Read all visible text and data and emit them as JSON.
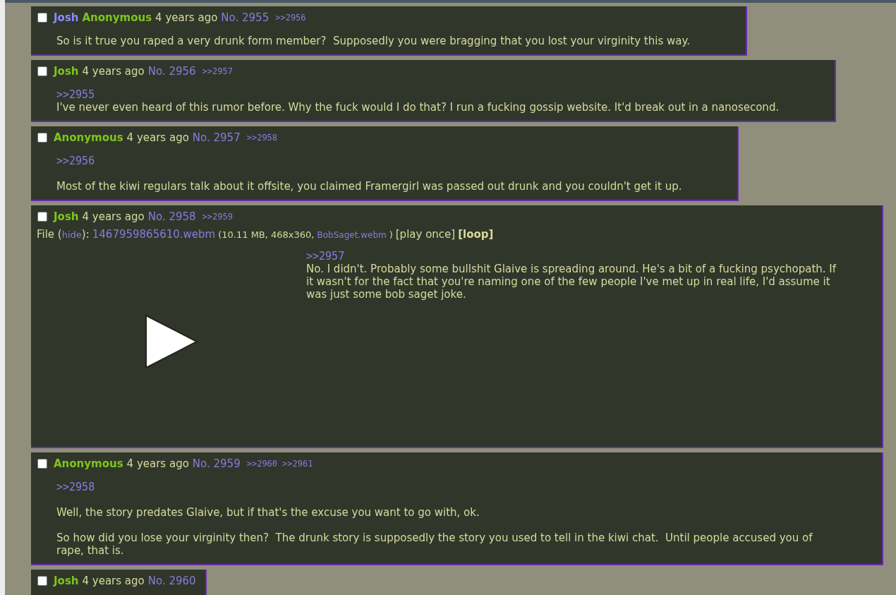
{
  "posts": [
    {
      "checked": false,
      "names": [
        {
          "kind": "link",
          "text": "Josh"
        },
        {
          "kind": "name",
          "text": "Anonymous"
        }
      ],
      "time": "4 years ago",
      "number": "No. 2955",
      "replies": [
        ">>2956"
      ],
      "body": [
        {
          "lines": [
            {
              "kind": "text",
              "text": "So is it true you raped a very drunk form member?  Supposedly you were bragging that you lost your virginity this way."
            }
          ]
        }
      ]
    },
    {
      "checked": false,
      "names": [
        {
          "kind": "name",
          "text": "Josh"
        }
      ],
      "time": "4 years ago",
      "number": "No. 2956",
      "replies": [
        ">>2957"
      ],
      "body": [
        {
          "lines": [
            {
              "kind": "quote",
              "text": ">>2955"
            },
            {
              "kind": "text",
              "text": "I've never even heard of this rumor before. Why the fuck would I do that? I run a fucking gossip website. It'd break out in a nanosecond."
            }
          ]
        }
      ]
    },
    {
      "checked": false,
      "names": [
        {
          "kind": "name",
          "text": "Anonymous"
        }
      ],
      "time": "4 years ago",
      "number": "No. 2957",
      "replies": [
        ">>2958"
      ],
      "body": [
        {
          "lines": [
            {
              "kind": "quote",
              "text": ">>2956"
            }
          ]
        },
        {
          "lines": [
            {
              "kind": "text",
              "text": "Most of the kiwi regulars talk about it offsite, you claimed Framergirl was passed out drunk and you couldn't get it up."
            }
          ]
        }
      ]
    },
    {
      "checked": false,
      "names": [
        {
          "kind": "name",
          "text": "Josh"
        }
      ],
      "time": "4 years ago",
      "number": "No. 2958",
      "replies": [
        ">>2959"
      ],
      "file": [
        {
          "kind": "text",
          "text": "File ("
        },
        {
          "kind": "link",
          "text": "hide"
        },
        {
          "kind": "text",
          "text": "):"
        },
        {
          "kind": "filename",
          "text": "1467959865610.webm"
        },
        {
          "kind": "small",
          "text": "(10.11 MB, 468x360,"
        },
        {
          "kind": "small-link",
          "text": "BobSaget.webm"
        },
        {
          "kind": "small",
          "text": ")"
        },
        {
          "kind": "control",
          "text": "[play once]",
          "selected": false
        },
        {
          "kind": "control",
          "text": "[loop]",
          "selected": true
        }
      ],
      "body": [
        {
          "lines": [
            {
              "kind": "quote",
              "text": ">>2957"
            },
            {
              "kind": "text",
              "text": "No. I didn't. Probably some bullshit Glaive is spreading around. He's a bit of a fucking psychopath. If it wasn't for the fact that you're naming one of the few people I've met up in real life, I'd assume it was just some bob saget joke."
            }
          ]
        }
      ]
    },
    {
      "checked": false,
      "names": [
        {
          "kind": "name",
          "text": "Anonymous"
        }
      ],
      "time": "4 years ago",
      "number": "No. 2959",
      "replies": [
        ">>2960",
        ">>2961"
      ],
      "body": [
        {
          "lines": [
            {
              "kind": "quote",
              "text": ">>2958"
            }
          ]
        },
        {
          "lines": [
            {
              "kind": "text",
              "text": "Well, the story predates Glaive, but if that's the excuse you want to go with, ok."
            }
          ]
        },
        {
          "lines": [
            {
              "kind": "text",
              "text": "So how did you lose your virginity then?  The drunk story is supposedly the story you used to tell in the kiwi chat.  Until people accused you of rape, that is."
            }
          ]
        }
      ]
    },
    {
      "checked": false,
      "names": [
        {
          "kind": "name",
          "text": "Josh"
        }
      ],
      "time": "4 years ago",
      "number": "No. 2960"
    }
  ]
}
